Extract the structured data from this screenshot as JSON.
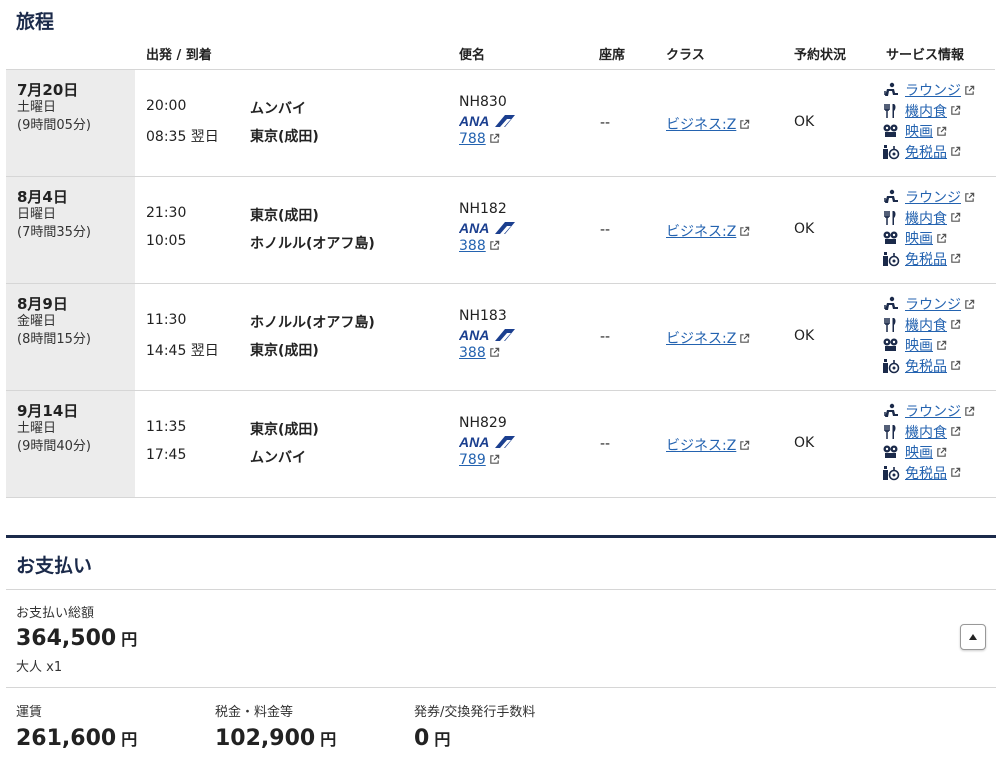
{
  "itinerary": {
    "title": "旅程",
    "columns": {
      "dep_arr": "出発 / 到着",
      "flight": "便名",
      "seat": "座席",
      "class": "クラス",
      "status": "予約状況",
      "service": "サービス情報"
    },
    "flights": [
      {
        "date": "7月20日",
        "weekday": "土曜日",
        "duration": "(9時間05分)",
        "dep_time": "20:00",
        "dep_city": "ムンバイ",
        "arr_time": "08:35 翌日",
        "arr_city": "東京(成田)",
        "flight_no": "NH830",
        "aircraft": "788",
        "seat": "--",
        "class": "ビジネス:Z",
        "status": "OK"
      },
      {
        "date": "8月4日",
        "weekday": "日曜日",
        "duration": "(7時間35分)",
        "dep_time": "21:30",
        "dep_city": "東京(成田)",
        "arr_time": "10:05",
        "arr_city": "ホノルル(オアフ島)",
        "flight_no": "NH182",
        "aircraft": "388",
        "seat": "--",
        "class": "ビジネス:Z",
        "status": "OK"
      },
      {
        "date": "8月9日",
        "weekday": "金曜日",
        "duration": "(8時間15分)",
        "dep_time": "11:30",
        "dep_city": "ホノルル(オアフ島)",
        "arr_time": "14:45 翌日",
        "arr_city": "東京(成田)",
        "flight_no": "NH183",
        "aircraft": "388",
        "seat": "--",
        "class": "ビジネス:Z",
        "status": "OK"
      },
      {
        "date": "9月14日",
        "weekday": "土曜日",
        "duration": "(9時間40分)",
        "dep_time": "11:35",
        "dep_city": "東京(成田)",
        "arr_time": "17:45",
        "arr_city": "ムンバイ",
        "flight_no": "NH829",
        "aircraft": "789",
        "seat": "--",
        "class": "ビジネス:Z",
        "status": "OK"
      }
    ],
    "services": [
      {
        "label": "ラウンジ",
        "icon": "lounge-icon"
      },
      {
        "label": "機内食",
        "icon": "meal-icon"
      },
      {
        "label": "映画",
        "icon": "movie-icon"
      },
      {
        "label": "免税品",
        "icon": "dutyfree-icon"
      }
    ],
    "airline_logo": "ANA"
  },
  "payment": {
    "title": "お支払い",
    "total_label": "お支払い総額",
    "total_amount": "364,500",
    "currency": "円",
    "passengers": "大人 x1",
    "fare_label": "運賃",
    "fare_amount": "261,600",
    "tax_label": "税金・料金等",
    "tax_amount": "102,900",
    "fee_label": "発券/交換発行手数料",
    "fee_amount": "0"
  },
  "colors": {
    "link": "#2463b0",
    "navy": "#1b2a4a",
    "date_bg": "#ececec"
  }
}
